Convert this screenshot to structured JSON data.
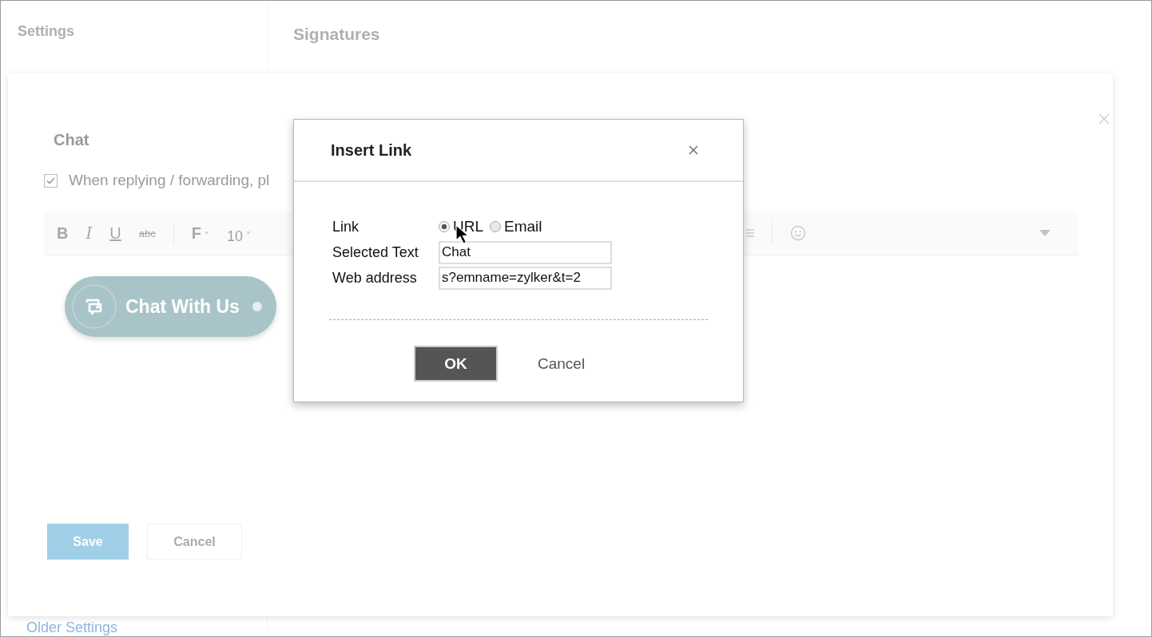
{
  "page": {
    "sidebar_title": "Settings",
    "section_title": "Signatures",
    "older_settings": "Older Settings"
  },
  "panel": {
    "title": "Chat",
    "checkbox": {
      "label": "When replying / forwarding, pl",
      "checked": true
    },
    "toolbar": [
      {
        "label": "B",
        "kind": "bold"
      },
      {
        "label": "I",
        "kind": "italic"
      },
      {
        "label": "U",
        "kind": "underline"
      },
      {
        "label": "abc",
        "kind": "strike"
      },
      {
        "label": "F",
        "kind": "font"
      },
      {
        "label": "10",
        "kind": "size"
      }
    ],
    "chat_button": {
      "label": "Chat With Us"
    },
    "buttons": [
      {
        "label": "Save",
        "kind": "primary"
      },
      {
        "label": "Cancel",
        "kind": "secondary"
      }
    ]
  },
  "dialog": {
    "title": "Insert Link",
    "link_label": "Link",
    "link_options": [
      {
        "label": "URL",
        "selected": true
      },
      {
        "label": "Email",
        "selected": false
      }
    ],
    "fields": [
      {
        "label": "Selected Text",
        "value": "Chat"
      },
      {
        "label": "Web address",
        "value": "s?emname=zylker&t=2"
      }
    ],
    "buttons": [
      {
        "label": "OK",
        "kind": "primary"
      },
      {
        "label": "Cancel",
        "kind": "link"
      }
    ]
  }
}
